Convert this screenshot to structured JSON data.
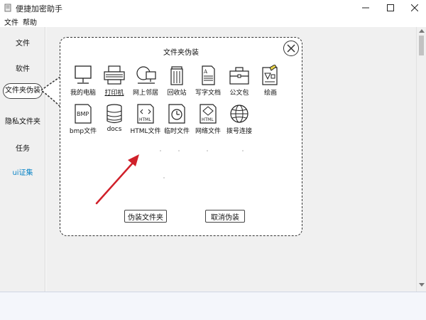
{
  "window": {
    "title": "便捷加密助手"
  },
  "menu": {
    "items": [
      "文件",
      "帮助"
    ]
  },
  "sidebar": {
    "items": [
      {
        "label": "文件"
      },
      {
        "label": "软件"
      },
      {
        "label": "文件夹伪装",
        "active": true
      },
      {
        "label": "隐私文件夹"
      },
      {
        "label": "任务"
      },
      {
        "label": "ui证集"
      }
    ]
  },
  "panel": {
    "title": "文件夹伪装",
    "icons": [
      {
        "label": "我的电脑",
        "icon": "computer-icon"
      },
      {
        "label": "打印机",
        "icon": "printer-icon"
      },
      {
        "label": "网上邻居",
        "icon": "network-neighborhood-icon"
      },
      {
        "label": "回收站",
        "icon": "recycle-bin-icon"
      },
      {
        "label": "写字文档",
        "icon": "text-document-icon"
      },
      {
        "label": "公文包",
        "icon": "briefcase-icon"
      },
      {
        "label": "绘画",
        "icon": "paint-icon"
      },
      {
        "label": "bmp文件",
        "icon": "bmp-file-icon"
      },
      {
        "label": "docs",
        "icon": "docs-stack-icon"
      },
      {
        "label": "HTML文件",
        "icon": "html-file-icon"
      },
      {
        "label": "临时文件",
        "icon": "temp-file-icon"
      },
      {
        "label": "网络文件",
        "icon": "network-file-icon"
      },
      {
        "label": "拨号连接",
        "icon": "dialup-globe-icon"
      }
    ],
    "buttons": {
      "disguise": "伪装文件夹",
      "cancel": "取消伪装"
    },
    "icon_text": {
      "bmp": "BMP",
      "html": "HTML"
    }
  },
  "colors": {
    "active_link": "#0a84c6",
    "arrow": "#d0202a",
    "sidebar_bg": "#f0f0f0"
  }
}
